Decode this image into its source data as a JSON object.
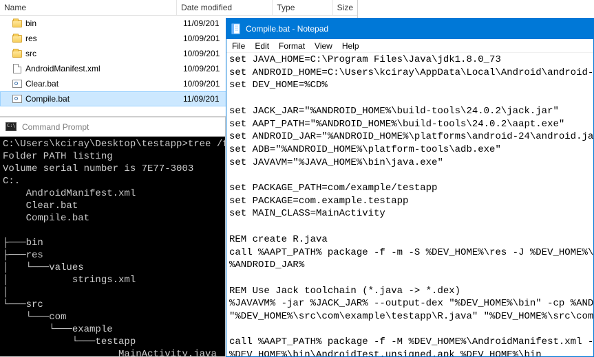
{
  "explorer": {
    "columns": {
      "name": "Name",
      "date": "Date modified",
      "type": "Type",
      "size": "Size"
    },
    "rows": [
      {
        "kind": "folder",
        "name": "bin",
        "date": "11/09/201"
      },
      {
        "kind": "folder",
        "name": "res",
        "date": "10/09/201"
      },
      {
        "kind": "folder",
        "name": "src",
        "date": "10/09/201"
      },
      {
        "kind": "file",
        "name": "AndroidManifest.xml",
        "date": "10/09/201"
      },
      {
        "kind": "bat",
        "name": "Clear.bat",
        "date": "10/09/201"
      },
      {
        "kind": "bat",
        "name": "Compile.bat",
        "date": "11/09/201",
        "selected": true
      }
    ]
  },
  "cmd": {
    "title": "Command Prompt",
    "body": "C:\\Users\\kciray\\Desktop\\testapp>tree /f\nFolder PATH listing\nVolume serial number is 7E77-3003\nC:.\n    AndroidManifest.xml\n    Clear.bat\n    Compile.bat\n\n├───bin\n├───res\n│   └───values\n│           strings.xml\n│\n└───src\n    └───com\n        └───example\n            └───testapp\n                    MainActivity.java\n"
  },
  "notepad": {
    "title": "Compile.bat - Notepad",
    "menu": {
      "file": "File",
      "edit": "Edit",
      "format": "Format",
      "view": "View",
      "help": "Help"
    },
    "body": "set JAVA_HOME=C:\\Program Files\\Java\\jdk1.8.0_73\nset ANDROID_HOME=C:\\Users\\kciray\\AppData\\Local\\Android\\android-sdk\nset DEV_HOME=%CD%\n\nset JACK_JAR=\"%ANDROID_HOME%\\build-tools\\24.0.2\\jack.jar\"\nset AAPT_PATH=\"%ANDROID_HOME%\\build-tools\\24.0.2\\aapt.exe\"\nset ANDROID_JAR=\"%ANDROID_HOME%\\platforms\\android-24\\android.jar\"\nset ADB=\"%ANDROID_HOME%\\platform-tools\\adb.exe\"\nset JAVAVM=\"%JAVA_HOME%\\bin\\java.exe\"\n\nset PACKAGE_PATH=com/example/testapp\nset PACKAGE=com.example.testapp\nset MAIN_CLASS=MainActivity\n\nREM create R.java\ncall %AAPT_PATH% package -f -m -S %DEV_HOME%\\res -J %DEV_HOME%\\src -\n%ANDROID_JAR%\n\nREM Use Jack toolchain (*.java -> *.dex)\n%JAVAVM% -jar %JACK_JAR% --output-dex \"%DEV_HOME%\\bin\" -cp %ANDROID\n\"%DEV_HOME%\\src\\com\\example\\testapp\\R.java\" \"%DEV_HOME%\\src\\com\\exa\n\ncall %AAPT_PATH% package -f -M %DEV_HOME%\\AndroidManifest.xml -S %D\n%DEV_HOME%\\bin\\AndroidTest.unsigned.apk %DEV_HOME%\\bin"
  }
}
